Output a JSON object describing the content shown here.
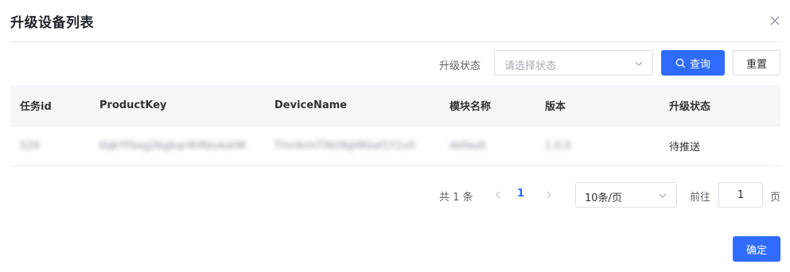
{
  "dialog": {
    "title": "升级设备列表",
    "close_icon": "close-icon"
  },
  "filter": {
    "label": "升级状态",
    "select_placeholder": "请选择状态",
    "query_label": "查询",
    "reset_label": "重置"
  },
  "table": {
    "headers": [
      "任务id",
      "ProductKey",
      "DeviceName",
      "模块名称",
      "版本",
      "升级状态"
    ],
    "rows": [
      {
        "task_id": "524",
        "product_key": "6qkYFbxg2bgkqr4hRbvkaHK",
        "device_name": "TmrArmTXkt9gHKkaf1Y1x5",
        "module_name": "default",
        "version": "1.0.0",
        "status": "待推送"
      }
    ]
  },
  "pagination": {
    "total": "共 1 条",
    "current_page": "1",
    "page_size": "10条/页",
    "goto_label": "前往",
    "goto_value": "1",
    "page_unit": "页"
  },
  "footer": {
    "confirm_label": "确定"
  },
  "colors": {
    "primary": "#2f6bff",
    "border": "#dcdfe6",
    "header_bg": "#f5f6f8"
  }
}
